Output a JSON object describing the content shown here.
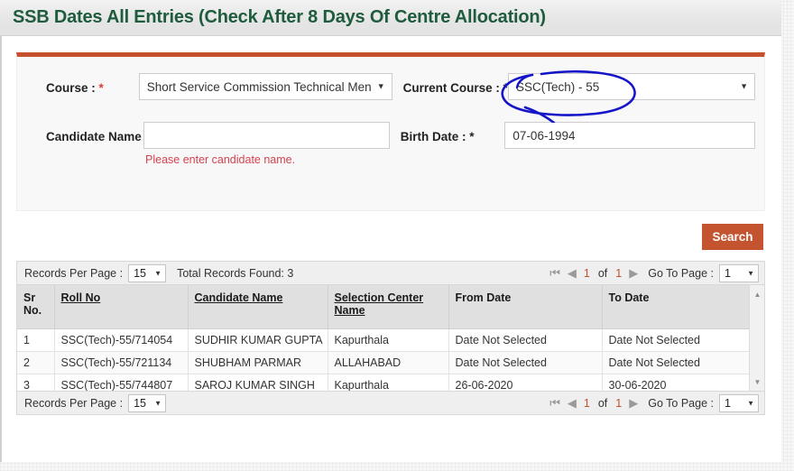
{
  "header": {
    "title": "SSB Dates All Entries (Check After 8 Days Of Centre Allocation)",
    "title_color": "#1f5c3d"
  },
  "theme": {
    "accent": "#c4502e",
    "panel_bg": "#f8f8f8",
    "error_text": "#d4424f",
    "annotation_color": "#1414c8"
  },
  "form": {
    "course": {
      "label": "Course :",
      "required_mark": "*",
      "value": "Short Service Commission Technical Men",
      "caret": "chevron-down-icon"
    },
    "current_course": {
      "label": "Current Course :",
      "required_mark": "*",
      "value": "SSC(Tech) - 55",
      "caret": "chevron-down-icon"
    },
    "candidate_name": {
      "label": "Candidate Name :",
      "required_mark": "*",
      "value": "",
      "placeholder": "",
      "error": "Please enter candidate name."
    },
    "birth_date": {
      "label": "Birth Date :",
      "required_mark": "*",
      "value": "07-06-1994"
    },
    "search_button": "Search"
  },
  "grid": {
    "records_per_page_label": "Records Per Page :",
    "records_per_page_value": "15",
    "total_records_text": "Total Records Found: 3",
    "pager": {
      "first_icon": "first-page-icon",
      "prev_icon": "previous-page-icon",
      "current_page": "1",
      "of_text": "of",
      "total_pages": "1",
      "next_icon": "next-page-icon",
      "goto_label": "Go To Page :",
      "goto_value": "1"
    },
    "columns": [
      {
        "label": "Sr No.",
        "link": false
      },
      {
        "label": "Roll No",
        "link": true
      },
      {
        "label": "Candidate Name",
        "link": true
      },
      {
        "label": "Selection Center Name",
        "link": true
      },
      {
        "label": "From Date",
        "link": false
      },
      {
        "label": "To Date",
        "link": false
      }
    ],
    "rows": [
      {
        "sr": "1",
        "roll_no": "SSC(Tech)-55/714054",
        "candidate_name": "SUDHIR KUMAR GUPTA",
        "selection_center": "Kapurthala",
        "from_date": "Date Not Selected",
        "to_date": "Date Not Selected"
      },
      {
        "sr": "2",
        "roll_no": "SSC(Tech)-55/721134",
        "candidate_name": "SHUBHAM PARMAR",
        "selection_center": "ALLAHABAD",
        "from_date": "Date Not Selected",
        "to_date": "Date Not Selected"
      },
      {
        "sr": "3",
        "roll_no": "SSC(Tech)-55/744807",
        "candidate_name": "SAROJ KUMAR SINGH",
        "selection_center": "Kapurthala",
        "from_date": "26-06-2020",
        "to_date": "30-06-2020"
      }
    ],
    "scrollbar": {
      "up_icon": "scroll-up-icon",
      "down_icon": "scroll-down-icon"
    }
  },
  "annotation": {
    "type": "hand-drawn-circle",
    "target": "SSC(Tech) - 55"
  }
}
